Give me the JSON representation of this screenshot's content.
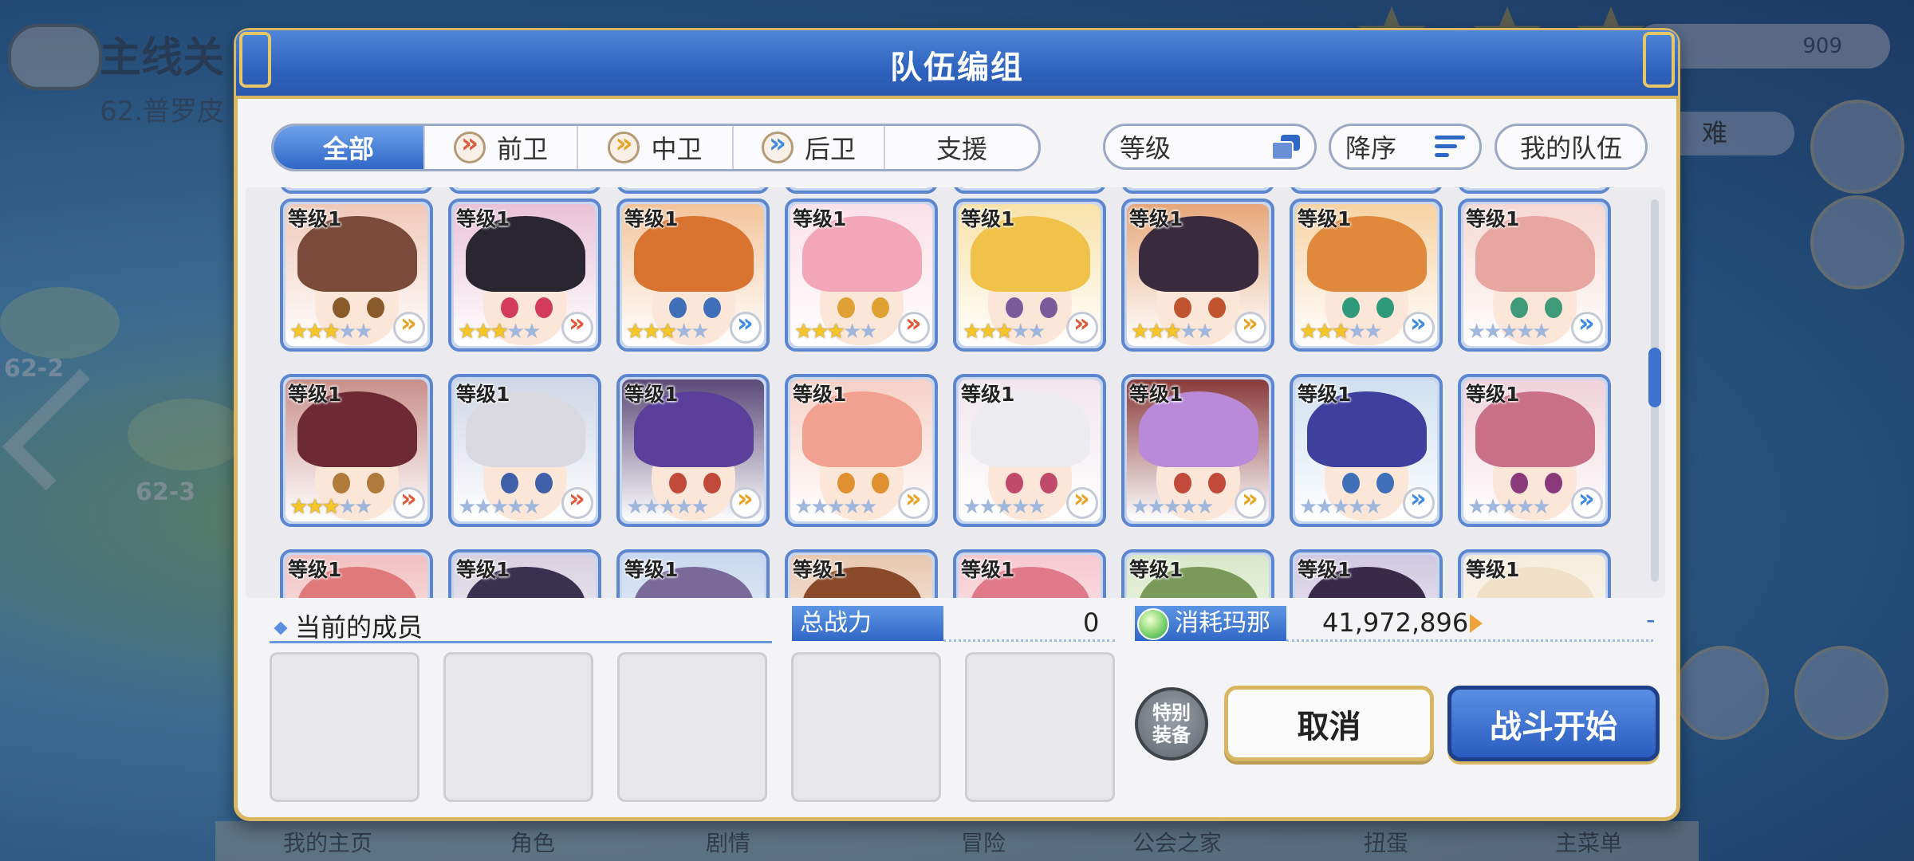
{
  "background": {
    "title": "主线关",
    "subtitle": "62.普罗皮",
    "gems": "909",
    "difficulty": "难",
    "node_labels": [
      "62-2",
      "62-3"
    ],
    "bottom_menu": [
      "我的主页",
      "角色",
      "剧情",
      "冒险",
      "公会之家",
      "扭蛋",
      "主菜单"
    ]
  },
  "dialog": {
    "title": "队伍编组",
    "tabs": [
      {
        "label": "全部",
        "icon": "none"
      },
      {
        "label": "前卫",
        "icon": "front-position-icon"
      },
      {
        "label": "中卫",
        "icon": "mid-position-icon"
      },
      {
        "label": "后卫",
        "icon": "back-position-icon"
      },
      {
        "label": "支援",
        "icon": "none"
      }
    ],
    "active_tab": "全部",
    "sort_field": "等级",
    "sort_order": "降序",
    "my_team": "我的队伍",
    "level_label": "等级1"
  },
  "characters": [
    {
      "stars": 3,
      "role": "mid",
      "hair": "#7a4a3a",
      "bg": "#f0c9b8",
      "eye": "#8b5a2b"
    },
    {
      "stars": 3,
      "role": "front",
      "hair": "#2a2630",
      "bg": "#e9c2d6",
      "eye": "#d23c5a"
    },
    {
      "stars": 3,
      "role": "back",
      "hair": "#d8742f",
      "bg": "#f3c49a",
      "eye": "#3f6fb8"
    },
    {
      "stars": 3,
      "role": "front",
      "hair": "#f3a6b8",
      "bg": "#fbe0ea",
      "eye": "#e0a033"
    },
    {
      "stars": 3,
      "role": "front",
      "hair": "#f1c24a",
      "bg": "#f8e2a8",
      "eye": "#7a5a9a"
    },
    {
      "stars": 3,
      "role": "mid",
      "hair": "#3a2a3e",
      "bg": "#e6a77a",
      "eye": "#c0542e"
    },
    {
      "stars": 3,
      "role": "back",
      "hair": "#e0893c",
      "bg": "#f7d2a2",
      "eye": "#2f9a7a"
    },
    {
      "stars": 0,
      "role": "back",
      "hair": "#e8a6a0",
      "bg": "#f6d8d2",
      "eye": "#3f9a7a"
    },
    {
      "stars": 3,
      "role": "front",
      "hair": "#6e2a34",
      "bg": "#c98f8a",
      "eye": "#b07a3a"
    },
    {
      "stars": 0,
      "role": "front",
      "hair": "#d9d9df",
      "bg": "#cfd6e6",
      "eye": "#3f5fa8"
    },
    {
      "stars": 0,
      "role": "mid",
      "hair": "#5b3f9a",
      "bg": "#5a4a78",
      "eye": "#c24a3a"
    },
    {
      "stars": 0,
      "role": "mid",
      "hair": "#f2a090",
      "bg": "#f6d0c6",
      "eye": "#e09030"
    },
    {
      "stars": 0,
      "role": "mid",
      "hair": "#ecebef",
      "bg": "#f1e6ec",
      "eye": "#c04a6a"
    },
    {
      "stars": 0,
      "role": "mid",
      "hair": "#b98ad8",
      "bg": "#8a3a3a",
      "eye": "#c24a3a"
    },
    {
      "stars": 0,
      "role": "back",
      "hair": "#3f3f9e",
      "bg": "#cfe0f0",
      "eye": "#3f6fb8"
    },
    {
      "stars": 0,
      "role": "back",
      "hair": "#c97088",
      "bg": "#f0d2da",
      "eye": "#8a3a7a"
    },
    {
      "stars": 0,
      "role": "none",
      "hair": "#e07a7a",
      "bg": "#f2c0c0",
      "eye": "#000000"
    },
    {
      "stars": 0,
      "role": "none",
      "hair": "#3a3050",
      "bg": "#d8d0e0",
      "eye": "#000000"
    },
    {
      "stars": 0,
      "role": "none",
      "hair": "#7a6a9a",
      "bg": "#c8d8ee",
      "eye": "#000000"
    },
    {
      "stars": 0,
      "role": "none",
      "hair": "#8a4a2a",
      "bg": "#e8c8b0",
      "eye": "#000000"
    },
    {
      "stars": 0,
      "role": "none",
      "hair": "#e07a8a",
      "bg": "#f6c8d0",
      "eye": "#000000"
    },
    {
      "stars": 0,
      "role": "none",
      "hair": "#7a9a5a",
      "bg": "#d8e8c8",
      "eye": "#000000"
    },
    {
      "stars": 0,
      "role": "none",
      "hair": "#3a2a4a",
      "bg": "#d0c8e0",
      "eye": "#000000"
    },
    {
      "stars": 0,
      "role": "none",
      "hair": "#f0e0c8",
      "bg": "#f6ecdc",
      "eye": "#000000"
    }
  ],
  "bottom": {
    "members_label": "当前的成员",
    "total_power_label": "总战力",
    "total_power": "0",
    "mana_label": "消耗玛那",
    "mana_value": "41,972,896",
    "mana_dash": "-",
    "special_gear": "特别装备",
    "cancel": "取消",
    "start": "战斗开始"
  },
  "colors": {
    "accent": "#2f67c6",
    "gold": "#d9b762"
  },
  "scroll_position": 0.46
}
